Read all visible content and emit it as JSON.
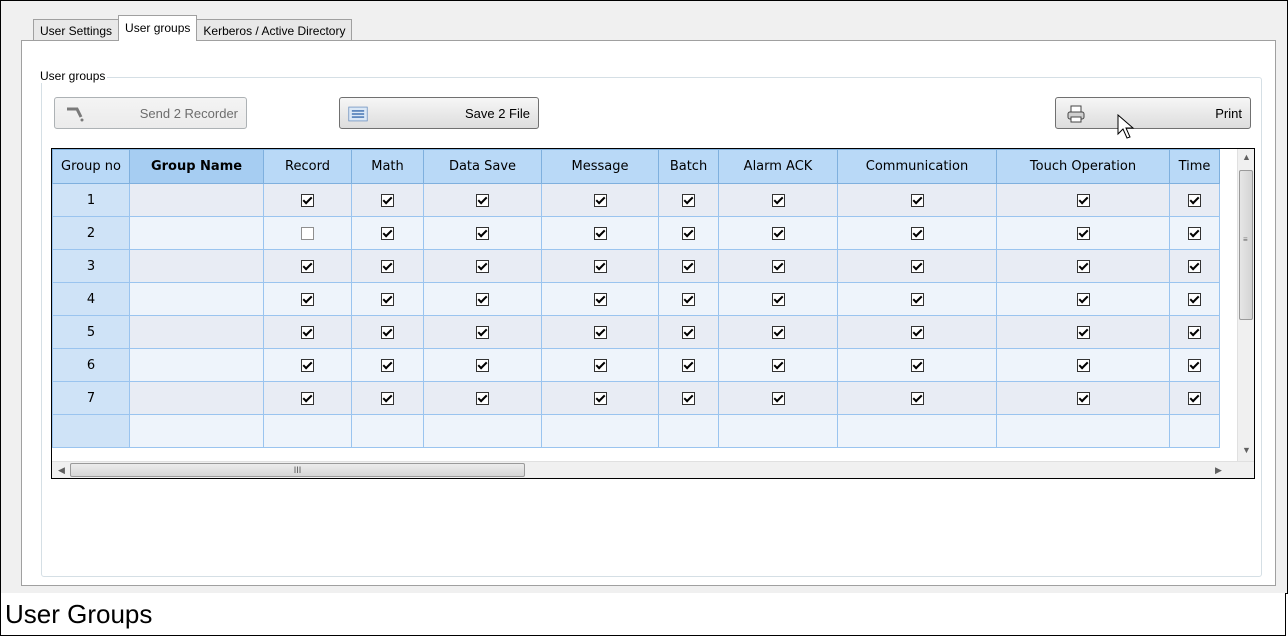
{
  "tabs": [
    {
      "label": "User Settings"
    },
    {
      "label": "User groups"
    },
    {
      "label": "Kerberos / Active Directory"
    }
  ],
  "groupbox_title": "User groups",
  "buttons": {
    "send": "Send 2 Recorder",
    "save": "Save 2 File",
    "print": "Print"
  },
  "columns": [
    "Group no",
    "Group Name",
    "Record",
    "Math",
    "Data Save",
    "Message",
    "Batch",
    "Alarm ACK",
    "Communication",
    "Touch Operation",
    "Time"
  ],
  "rows": [
    {
      "no": "1",
      "name": "",
      "checks": [
        true,
        true,
        true,
        true,
        true,
        true,
        true,
        true,
        true
      ]
    },
    {
      "no": "2",
      "name": "",
      "checks": [
        false,
        true,
        true,
        true,
        true,
        true,
        true,
        true,
        true
      ]
    },
    {
      "no": "3",
      "name": "",
      "checks": [
        true,
        true,
        true,
        true,
        true,
        true,
        true,
        true,
        true
      ]
    },
    {
      "no": "4",
      "name": "",
      "checks": [
        true,
        true,
        true,
        true,
        true,
        true,
        true,
        true,
        true
      ]
    },
    {
      "no": "5",
      "name": "",
      "checks": [
        true,
        true,
        true,
        true,
        true,
        true,
        true,
        true,
        true
      ]
    },
    {
      "no": "6",
      "name": "",
      "checks": [
        true,
        true,
        true,
        true,
        true,
        true,
        true,
        true,
        true
      ]
    },
    {
      "no": "7",
      "name": "",
      "checks": [
        true,
        true,
        true,
        true,
        true,
        true,
        true,
        true,
        true
      ]
    }
  ],
  "hscroll_thumb_label": "III",
  "caption": "User Groups"
}
